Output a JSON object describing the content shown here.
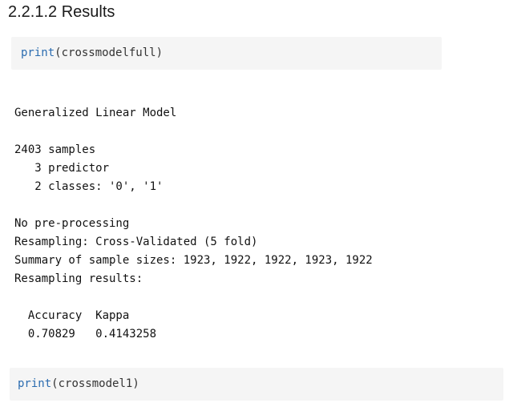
{
  "heading": "2.2.1.2 Results",
  "code1": {
    "fn": "print",
    "open": "(",
    "arg": "crossmodelfull",
    "close": ")"
  },
  "output": {
    "lines": [
      "Generalized Linear Model",
      "",
      "2403 samples",
      "   3 predictor",
      "   2 classes: '0', '1'",
      "",
      "No pre-processing",
      "Resampling: Cross-Validated (5 fold)",
      "Summary of sample sizes: 1923, 1922, 1922, 1923, 1922",
      "Resampling results:",
      "",
      "  Accuracy  Kappa    ",
      "  0.70829   0.4143258"
    ]
  },
  "code2": {
    "fn": "print",
    "open": "(",
    "arg": "crossmodel1",
    "close": ")"
  }
}
